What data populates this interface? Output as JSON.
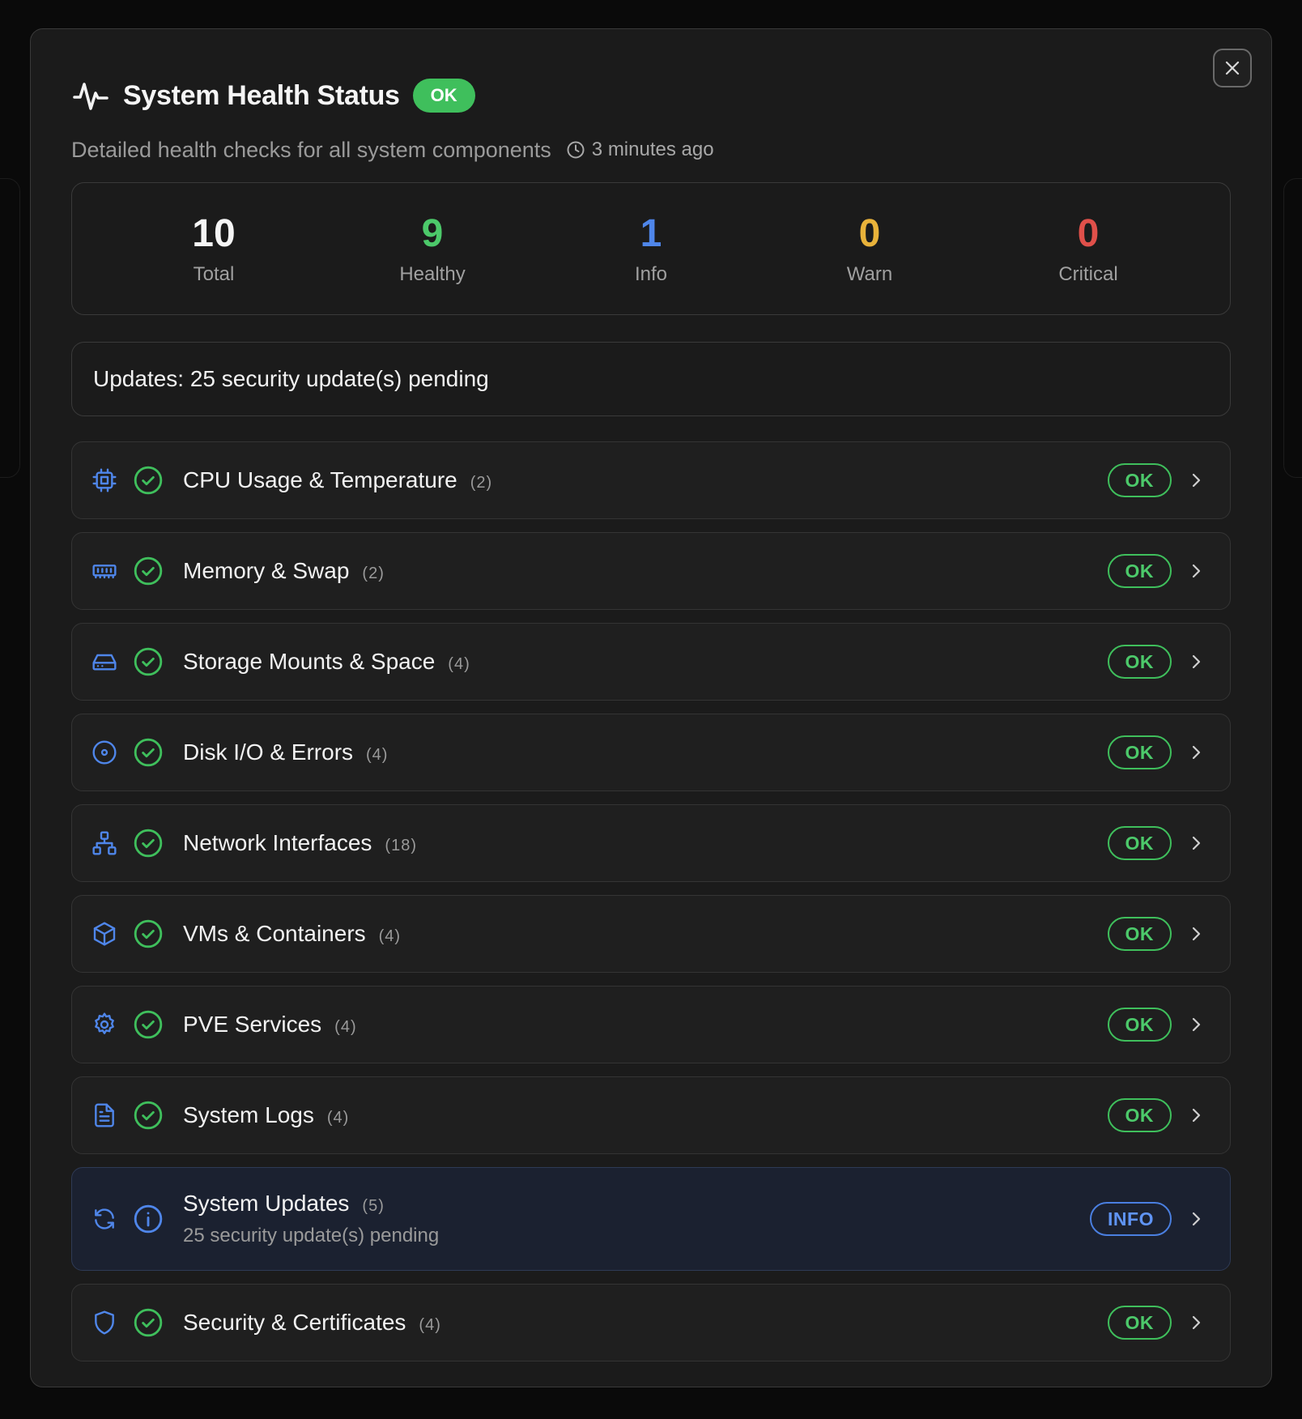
{
  "header": {
    "title": "System Health Status",
    "status_pill": "OK",
    "subtitle": "Detailed health checks for all system components",
    "last_checked": "3 minutes ago"
  },
  "stats": [
    {
      "value": "10",
      "label": "Total",
      "color": "#f5f5f5"
    },
    {
      "value": "9",
      "label": "Healthy",
      "color": "#4cc96a"
    },
    {
      "value": "1",
      "label": "Info",
      "color": "#4f86ea"
    },
    {
      "value": "0",
      "label": "Warn",
      "color": "#e8b23a"
    },
    {
      "value": "0",
      "label": "Critical",
      "color": "#e0504a"
    }
  ],
  "banner": "Updates: 25 security update(s) pending",
  "checks": [
    {
      "name": "CPU Usage & Temperature",
      "count": "(2)",
      "status": "OK",
      "icon": "cpu-icon",
      "status_icon": "check-circle-icon"
    },
    {
      "name": "Memory & Swap",
      "count": "(2)",
      "status": "OK",
      "icon": "memory-icon",
      "status_icon": "check-circle-icon"
    },
    {
      "name": "Storage Mounts & Space",
      "count": "(4)",
      "status": "OK",
      "icon": "hard-drive-icon",
      "status_icon": "check-circle-icon"
    },
    {
      "name": "Disk I/O & Errors",
      "count": "(4)",
      "status": "OK",
      "icon": "disc-icon",
      "status_icon": "check-circle-icon"
    },
    {
      "name": "Network Interfaces",
      "count": "(18)",
      "status": "OK",
      "icon": "network-icon",
      "status_icon": "check-circle-icon"
    },
    {
      "name": "VMs & Containers",
      "count": "(4)",
      "status": "OK",
      "icon": "box-icon",
      "status_icon": "check-circle-icon"
    },
    {
      "name": "PVE Services",
      "count": "(4)",
      "status": "OK",
      "icon": "gear-icon",
      "status_icon": "check-circle-icon"
    },
    {
      "name": "System Logs",
      "count": "(4)",
      "status": "OK",
      "icon": "file-text-icon",
      "status_icon": "check-circle-icon"
    },
    {
      "name": "System Updates",
      "count": "(5)",
      "status": "INFO",
      "detail": "25 security update(s) pending",
      "icon": "refresh-icon",
      "status_icon": "info-circle-icon"
    },
    {
      "name": "Security & Certificates",
      "count": "(4)",
      "status": "OK",
      "icon": "shield-icon",
      "status_icon": "check-circle-icon"
    }
  ],
  "colors": {
    "ok": "#3fbf5c",
    "info": "#4a7fe0",
    "icon_blue": "#4f86ea",
    "background": "#1b1b1b"
  }
}
